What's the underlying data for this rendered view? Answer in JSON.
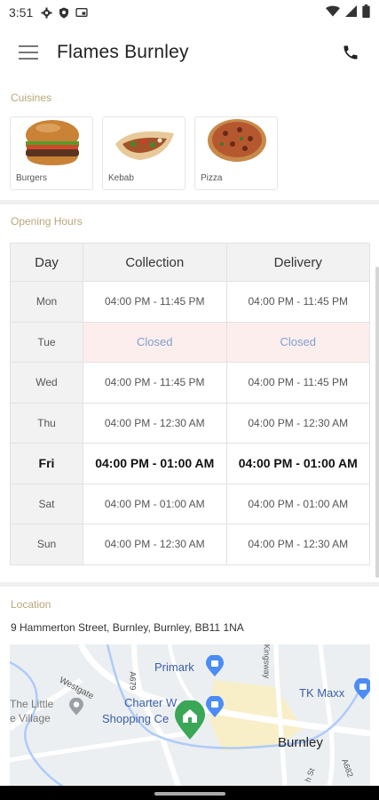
{
  "status_bar": {
    "time": "3:51"
  },
  "app_bar": {
    "title": "Flames Burnley"
  },
  "cuisines": {
    "label": "Cuisines",
    "items": [
      {
        "label": "Burgers"
      },
      {
        "label": "Kebab"
      },
      {
        "label": "Pizza"
      }
    ]
  },
  "opening_hours": {
    "label": "Opening Hours",
    "headers": [
      "Day",
      "Collection",
      "Delivery"
    ],
    "rows": [
      {
        "day": "Mon",
        "collection": "04:00 PM - 11:45 PM",
        "delivery": "04:00 PM - 11:45 PM"
      },
      {
        "day": "Tue",
        "collection": "Closed",
        "delivery": "Closed"
      },
      {
        "day": "Wed",
        "collection": "04:00 PM - 11:45 PM",
        "delivery": "04:00 PM - 11:45 PM"
      },
      {
        "day": "Thu",
        "collection": "04:00 PM - 12:30 AM",
        "delivery": "04:00 PM - 12:30 AM"
      },
      {
        "day": "Fri",
        "collection": "04:00 PM - 01:00 AM",
        "delivery": "04:00 PM - 01:00 AM"
      },
      {
        "day": "Sat",
        "collection": "04:00 PM - 01:00 AM",
        "delivery": "04:00 PM - 01:00 AM"
      },
      {
        "day": "Sun",
        "collection": "04:00 PM - 12:30 AM",
        "delivery": "04:00 PM - 12:30 AM"
      }
    ]
  },
  "location": {
    "label": "Location",
    "address": "9 Hammerton Street, Burnley, Burnley, BB11 1NA",
    "map": {
      "labels": {
        "primark": "Primark",
        "tk_maxx": "TK Maxx",
        "charter_walk_1": "Charter W",
        "charter_walk_2": "Shopping Ce",
        "westgate": "Westgate",
        "the_little_1": "The Little",
        "the_little_2": "e Village",
        "burnley": "Burnley",
        "kingsway": "Kingsway",
        "a679": "A679",
        "a682": "A682",
        "st": "h St"
      }
    }
  },
  "colors": {
    "section_label": "#b9a67a",
    "closed_bg": "#fdeeee",
    "closed_text": "#7fa0c9",
    "map_pin": "#3aa757"
  }
}
